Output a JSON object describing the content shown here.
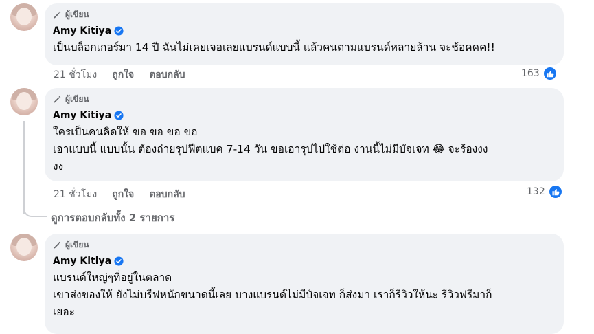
{
  "comments": [
    {
      "badge": "ผู้เขียน",
      "name": "Amy Kitiya",
      "lines": [
        "เป็นบล็อกเกอร์มา 14 ปี ฉันไม่เคยเจอเลยแบรนด์แบบนี้ แล้วคนตามแบรนด์หลายล้าน จะช้อคคค!!"
      ],
      "time": "21 ชั่วโมง",
      "like_label": "ถูกใจ",
      "reply_label": "ตอบกลับ",
      "reaction_count": "163"
    },
    {
      "badge": "ผู้เขียน",
      "name": "Amy Kitiya",
      "lines": [
        "ใครเป็นคนคิดให้ ขอ ขอ ขอ ขอ",
        "เอาแบบนี้ แบบนั้น ต้องถ่ายรุปฟีตแบค 7-14 วัน ขอเอารุปไปใช้ต่อ งานนี้ไม่มีบัจเจท 😂 จะร้องงง",
        "งง"
      ],
      "time": "21 ชั่วโมง",
      "like_label": "ถูกใจ",
      "reply_label": "ตอบกลับ",
      "reaction_count": "132"
    },
    {
      "badge": "ผู้เขียน",
      "name": "Amy Kitiya",
      "lines": [
        "แบรนด์ใหญ่ๆที่อยู่ในตลาด",
        "เขาส่งของให้ ยังไม่บรีฟหนักขนาดนี้เลย บางแบรนด์ไม่มีบัจเจท ก็ส่งมา เราก็รีวิวให้นะ รีวิวฟรีมาก็",
        "เยอะ"
      ]
    }
  ],
  "view_replies": "ดูการตอบกลับทั้ง 2 รายการ",
  "colors": {
    "bubble": "#f0f2f5",
    "secondary_text": "#65676b",
    "accent": "#1877f2"
  },
  "icons": {
    "badge": "pencil-icon",
    "verified": "verified-badge-icon",
    "reaction": "like-thumb-icon"
  }
}
